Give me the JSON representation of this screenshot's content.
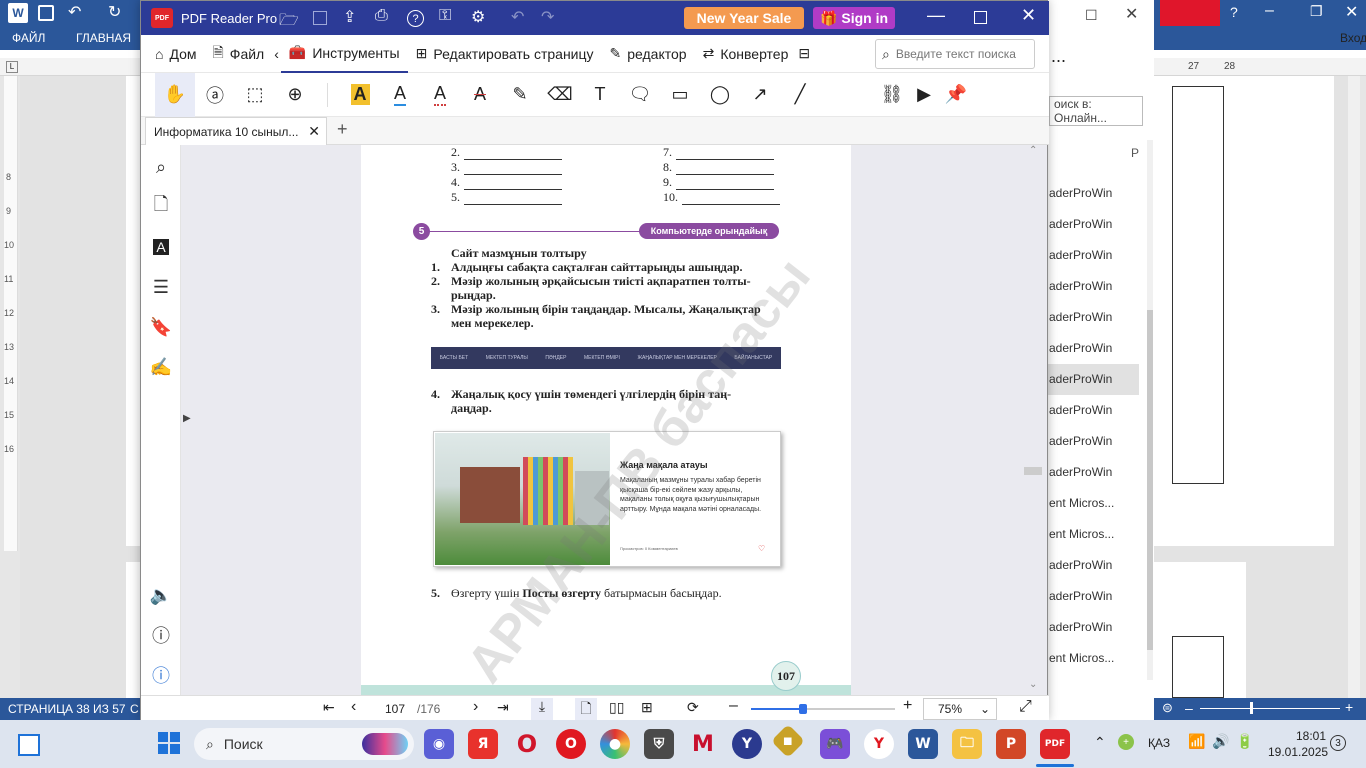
{
  "word": {
    "tab_file": "ФАЙЛ",
    "tab_home": "ГЛАВНАЯ",
    "tab_login": "Вход",
    "status_page": "СТРАНИЦА 38 ИЗ 57",
    "status_c": "С",
    "ruler_marks": [
      "27",
      "28"
    ],
    "left_ruler_marks": [
      "8",
      "9",
      "10",
      "11",
      "12",
      "13",
      "14",
      "15",
      "16"
    ]
  },
  "side_dialog": {
    "search_placeholder": "оиск в: Онлайн...",
    "items": [
      "aderProWin",
      "aderProWin",
      "aderProWin",
      "aderProWin",
      "aderProWin",
      "aderProWin",
      "aderProWin",
      "aderProWin",
      "aderProWin",
      "aderProWin",
      "ent Micros...",
      "ent Micros...",
      "aderProWin",
      "aderProWin",
      "aderProWin",
      "ent Micros..."
    ]
  },
  "pdf": {
    "app_name": "PDF Reader Pro",
    "new_year_sale": "New Year Sale",
    "sign_in": "Sign in",
    "menu": {
      "home": "Дом",
      "file": "Файл",
      "tools": "Инструменты",
      "edit_page": "Редактировать страницу",
      "editor": "редактор",
      "converter": "Конвертер"
    },
    "search_placeholder": "Введите текст поиска",
    "tab_title": "Информатика 10  сыныл...",
    "page_current": "107",
    "page_total": "/176",
    "zoom": "75%",
    "colors": {
      "title_bar": "#2c3b97",
      "sale": "#f49a50",
      "sign_in": "#b03bc6"
    }
  },
  "page": {
    "list_left": [
      "2.",
      "3.",
      "4.",
      "5."
    ],
    "list_right": [
      "7.",
      "8.",
      "9.",
      "10."
    ],
    "section_num": "5",
    "section_badge": "Компьютерде орындайық",
    "heading": "Сайт мазмұнын толтыру",
    "steps": [
      {
        "n": "1.",
        "text": "Алдыңғы сабақта сақталған сайттарыңды ашыңдар."
      },
      {
        "n": "2.",
        "text": "Мәзір жолының әрқайсысын тиісті ақпаратпен толты-"
      },
      {
        "n": "",
        "text": "рыңдар."
      },
      {
        "n": "3.",
        "text": "Мәзір жолының бірін таңдаңдар. Мысалы, "
      },
      {
        "n": "",
        "text": "мен мерекелер."
      }
    ],
    "step3_bold": "Жаңалықтар",
    "nav_items": [
      "БАСТЫ БЕТ",
      "МЕКТЕП ТУРАЛЫ",
      "ПӘНДЕР",
      "МЕКТЕП ӨМІРІ",
      "ЖАҢАЛЫҚТАР МЕН МЕРЕКЕЛЕР",
      "БАЙЛАНЫСТАР"
    ],
    "step4_n": "4.",
    "step4_a": "Жаңалық қосу үшін төмендегі үлгілердің бірін таң-",
    "step4_b": "даңдар.",
    "article_title": "Жаңа мақала атауы",
    "article_text": "Мақаланың мазмұны туралы хабар беретін қысқаша бір-екі сөйлем жазу арқылы, мақаланы толық оқуға қызығушылықтарын арттыру. Мұнда мақала мәтіні орналасады.",
    "article_footer": "Просмотров: 0    Комментарииев",
    "step5_n": "5.",
    "step5_a": "Өзгерту үшін ",
    "step5_bold": "Посты өзгерту",
    "step5_b": " батырмасын басыңдар.",
    "page_number": "107",
    "watermark": "АРМАН-ПВ баспасы"
  },
  "taskbar": {
    "search": "Поиск",
    "lang": "ҚАЗ",
    "time": "18:01",
    "date": "19.01.2025",
    "notif": "3"
  }
}
